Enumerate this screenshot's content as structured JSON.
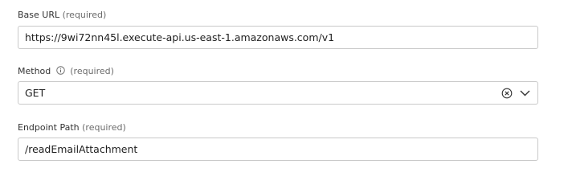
{
  "base_url": {
    "label": "Base URL",
    "required": "(required)",
    "value": "https://9wi72nn45l.execute-api.us-east-1.amazonaws.com/v1"
  },
  "method": {
    "label": "Method",
    "required": "(required)",
    "value": "GET",
    "icons": [
      "info-icon",
      "clear-icon",
      "chevron-down-icon"
    ]
  },
  "endpoint_path": {
    "label": "Endpoint Path",
    "required": "(required)",
    "value": "/readEmailAttachment"
  }
}
